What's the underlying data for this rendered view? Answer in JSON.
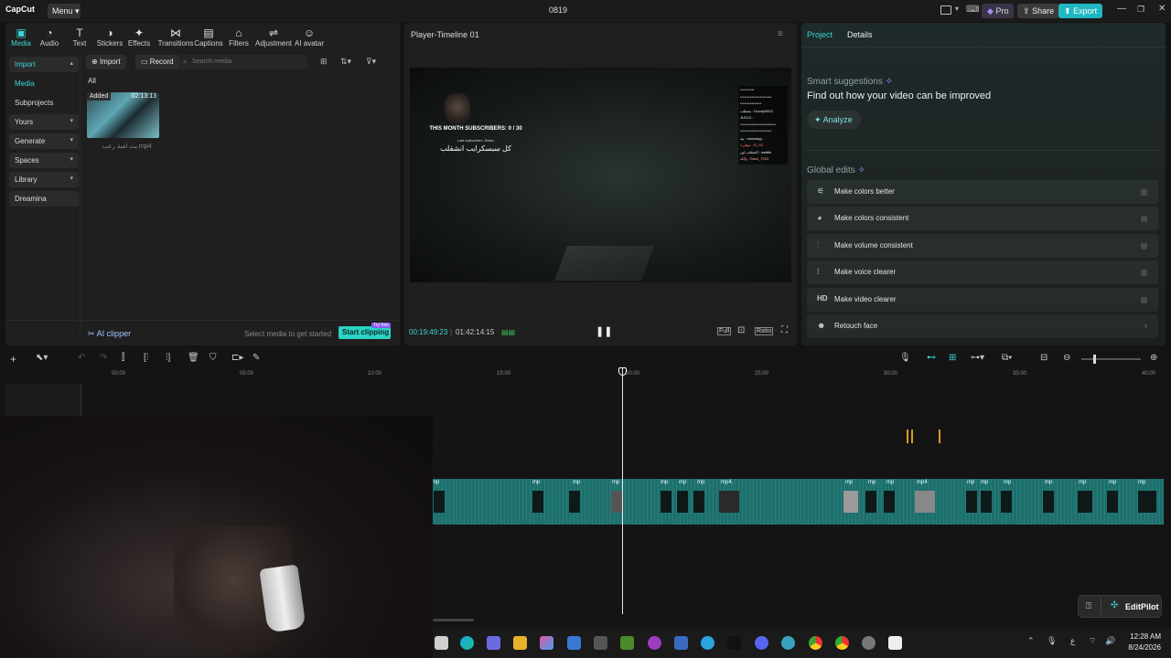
{
  "titlebar": {
    "logo": "CapCut",
    "menu_label": "Menu ▾",
    "project_name": "0819",
    "pro_label": "Pro",
    "share_label": "Share",
    "export_label": "Export"
  },
  "toolbar": {
    "items": [
      "Media",
      "Audio",
      "Text",
      "Stickers",
      "Effects",
      "Transitions",
      "Captions",
      "Filters",
      "Adjustment",
      "AI avatar"
    ]
  },
  "sidenav": {
    "items": [
      {
        "label": "Import",
        "chev": "▴"
      },
      {
        "label": "Media",
        "chev": ""
      },
      {
        "label": "Subprojects",
        "chev": ""
      },
      {
        "label": "Yours",
        "chev": "▾"
      },
      {
        "label": "Generate",
        "chev": "▾"
      },
      {
        "label": "Spaces",
        "chev": "▾"
      },
      {
        "label": "Library",
        "chev": "▾"
      },
      {
        "label": "Dreamina",
        "chev": ""
      }
    ]
  },
  "media": {
    "import_label": "Import",
    "record_label": "Record",
    "search_placeholder": "Search media",
    "filter_all": "All",
    "thumb_badge": "Added",
    "thumb_duration": "02:13:13",
    "thumb_name": "بث لعبة رعب.mp4",
    "ai_clipper_label": "AI clipper",
    "select_hint": "Select media to get started",
    "start_clipping_label": "Start clipping",
    "try_free": "Try free"
  },
  "player": {
    "title": "Player-Timeline 01",
    "current_time": "00:19:49:23",
    "total_time": "01:42:14:15",
    "overlay_sub_count": "THIS MONTH SUBSCRIBERS: 0 / 30",
    "overlay_last_sub": "Last subscriber: 2bdxz",
    "overlay_arabic": "كل سبسكرايب انشقلب",
    "chat_lines": [
      "**********",
      "**********************",
      "***************",
      "نشقلب : Doody0912",
      "JLELO :",
      "*************************",
      "**********************",
      "بيه : xsoossyy",
      "Lموفي : B_HZ",
      "الشقلب لين : swible",
      "والله : Bass_7333"
    ],
    "btn_full": "Full",
    "btn_ratio": "Ratio"
  },
  "right_panel": {
    "tab_project": "Project",
    "tab_details": "Details",
    "smart_title": "Smart suggestions",
    "smart_desc": "Find out how your video can be improved",
    "analyze_label": "Analyze",
    "global_title": "Global edits",
    "edits": [
      {
        "icon": "wand",
        "label": "Make colors better"
      },
      {
        "icon": "palette",
        "label": "Make colors consistent"
      },
      {
        "icon": "sliders",
        "label": "Make volume consistent"
      },
      {
        "icon": "waveform",
        "label": "Make voice clearer"
      },
      {
        "icon": "HD",
        "label": "Make video clearer"
      },
      {
        "icon": "face",
        "label": "Retouch face"
      }
    ]
  },
  "timeline": {
    "ticks": [
      "00:00",
      "05:00",
      "10:00",
      "15:00",
      "20:00",
      "25:00",
      "30:00",
      "35:00",
      "40:00"
    ],
    "clip_labels": [
      "mp",
      "mp",
      "mp",
      "mp",
      "mp",
      "mp",
      "mp",
      "mp",
      "mp4.",
      "mp",
      "mp",
      "mp",
      "mp",
      "mp4.",
      "mp",
      "mp",
      "mp",
      "mp",
      "mp",
      "mp",
      "mp"
    ]
  },
  "editpilot": {
    "label": "EditPilot"
  },
  "taskbar": {
    "time": "12:28 AM",
    "date": "8/24/2026",
    "lang": "ع"
  },
  "colors": {
    "accent": "#3ad6d6",
    "export_bg": "#1fb8c1",
    "track": "#1e6f6c"
  }
}
